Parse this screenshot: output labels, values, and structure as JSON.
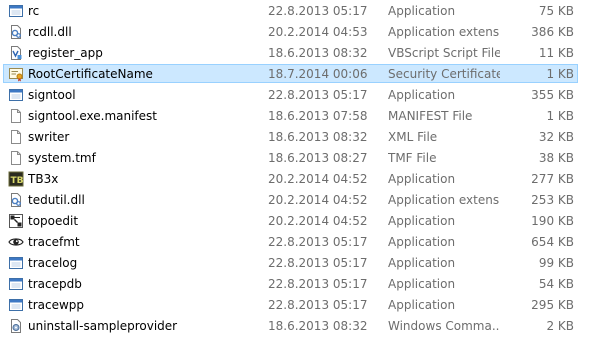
{
  "files": [
    {
      "name": "rc",
      "date": "22.8.2013 05:17",
      "type": "Application",
      "size": "75 KB",
      "icon": "application-icon"
    },
    {
      "name": "rcdll.dll",
      "date": "20.2.2014 04:53",
      "type": "Application extens...",
      "size": "386 KB",
      "icon": "dll-icon"
    },
    {
      "name": "register_app",
      "date": "18.6.2013 08:32",
      "type": "VBScript Script File",
      "size": "11 KB",
      "icon": "vbscript-icon"
    },
    {
      "name": "RootCertificateName",
      "date": "18.7.2014 00:06",
      "type": "Security Certificate",
      "size": "1 KB",
      "icon": "certificate-icon"
    },
    {
      "name": "signtool",
      "date": "22.8.2013 05:17",
      "type": "Application",
      "size": "355 KB",
      "icon": "application-icon"
    },
    {
      "name": "signtool.exe.manifest",
      "date": "18.6.2013 07:58",
      "type": "MANIFEST File",
      "size": "1 KB",
      "icon": "blank-file-icon"
    },
    {
      "name": "swriter",
      "date": "18.6.2013 08:32",
      "type": "XML File",
      "size": "32 KB",
      "icon": "blank-file-icon"
    },
    {
      "name": "system.tmf",
      "date": "18.6.2013 08:27",
      "type": "TMF File",
      "size": "38 KB",
      "icon": "blank-file-icon"
    },
    {
      "name": "TB3x",
      "date": "20.2.2014 04:52",
      "type": "Application",
      "size": "277 KB",
      "icon": "tb3x-icon"
    },
    {
      "name": "tedutil.dll",
      "date": "20.2.2014 04:52",
      "type": "Application extens...",
      "size": "253 KB",
      "icon": "dll-icon"
    },
    {
      "name": "topoedit",
      "date": "20.2.2014 04:52",
      "type": "Application",
      "size": "190 KB",
      "icon": "topoedit-icon"
    },
    {
      "name": "tracefmt",
      "date": "22.8.2013 05:17",
      "type": "Application",
      "size": "654 KB",
      "icon": "eye-icon"
    },
    {
      "name": "tracelog",
      "date": "22.8.2013 05:17",
      "type": "Application",
      "size": "99 KB",
      "icon": "application-icon"
    },
    {
      "name": "tracepdb",
      "date": "22.8.2013 05:17",
      "type": "Application",
      "size": "54 KB",
      "icon": "application-icon"
    },
    {
      "name": "tracewpp",
      "date": "22.8.2013 05:17",
      "type": "Application",
      "size": "295 KB",
      "icon": "application-icon"
    },
    {
      "name": "uninstall-sampleprovider",
      "date": "18.6.2013 08:32",
      "type": "Windows Comma...",
      "size": "2 KB",
      "icon": "cmd-script-icon"
    }
  ],
  "selected_index": 3
}
